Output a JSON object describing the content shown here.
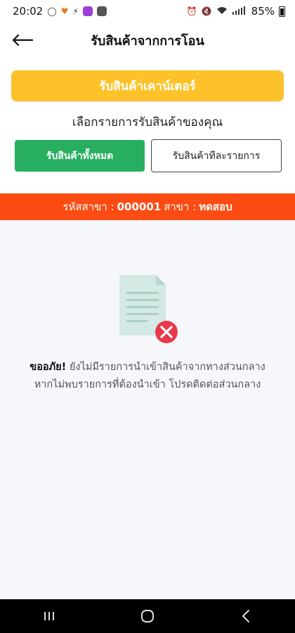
{
  "status_bar": {
    "time": "20:02",
    "battery": "85%"
  },
  "header": {
    "title": "รับสินค้าจากการโอน"
  },
  "actions": {
    "counter_button": "รับสินค้าเคาน์เตอร์",
    "choose_label": "เลือกรายการรับสินค้าของคุณ",
    "tab_all": "รับสินค้าทั้งหมด",
    "tab_each": "รับสินค้าทีละรายการ"
  },
  "branch": {
    "code_label": "รหัสสาขา :",
    "code_value": "000001",
    "name_label": "สาขา :",
    "name_value": "ทดสอบ"
  },
  "empty_state": {
    "apology": "ขออภัย!",
    "line1": "ยังไม่มีรายการนำเข้าสินค้าจากทางส่วนกลาง",
    "line2": "หากไม่พบรายการที่ต้องนำเข้า โปรดติดต่อส่วนกลาง"
  },
  "colors": {
    "counter_button": "#fdc22a",
    "tab_all": "#27ae60",
    "branch_bar": "#fc4c13",
    "error": "#e8394b"
  }
}
